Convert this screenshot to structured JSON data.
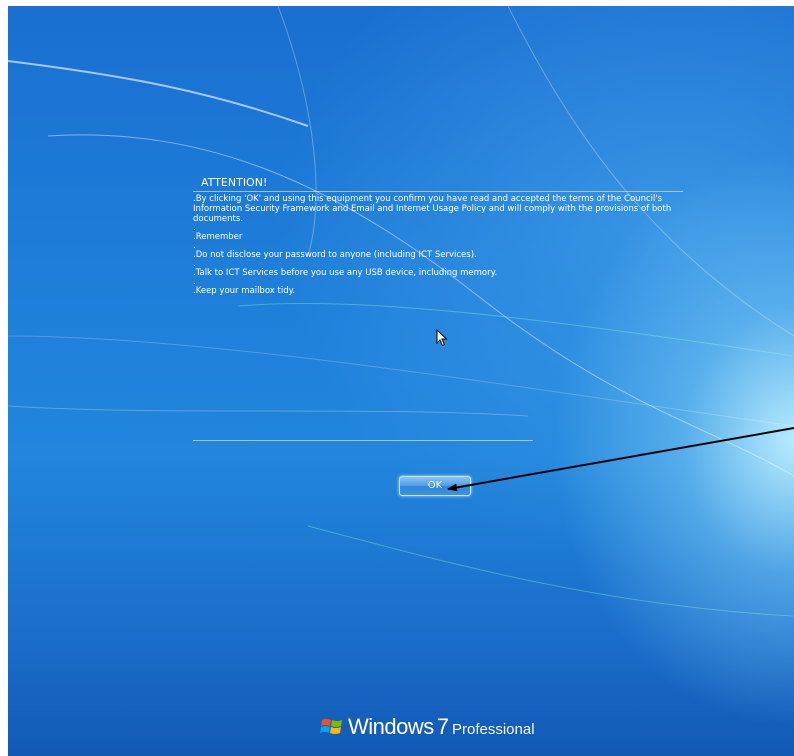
{
  "notice": {
    "title": "ATTENTION!",
    "paragraphs": [
      ".By clicking 'OK' and using this equipment you confirm you have read and accepted the terms of the Council's Information Security Framework and Email and Internet Usage Policy and will comply with the provisions of both documents.",
      ".",
      ".Remember",
      ".",
      ".Do not disclose your password to anyone (including ICT Services).",
      ".",
      ".Talk to ICT Services before you use any USB device, including memory.",
      ".",
      ".Keep your mailbox tidy."
    ]
  },
  "ok_button": {
    "label": "OK"
  },
  "branding": {
    "windows": "Windows",
    "version": "7",
    "edition": "Professional"
  },
  "colors": {
    "background": "#1e7ed9",
    "text": "#ffffff",
    "annotation_arrow": "#000000"
  },
  "icons": {
    "cursor": "mouse-pointer-icon",
    "logo": "windows-flag-icon",
    "annotation": "annotation-arrow"
  }
}
